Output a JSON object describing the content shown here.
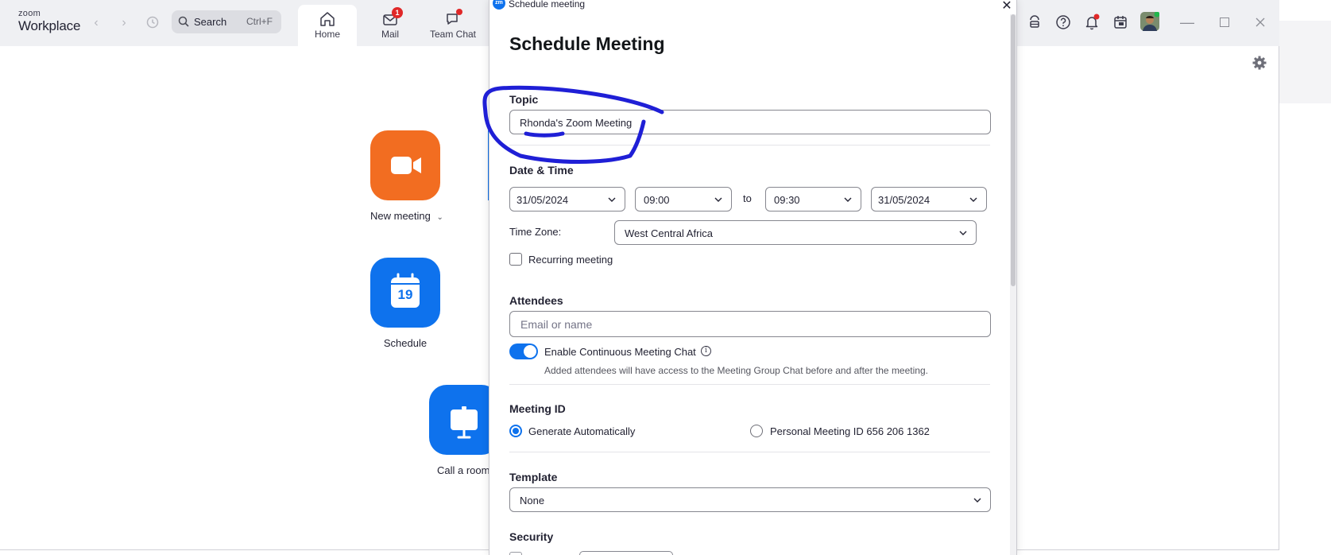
{
  "app": {
    "logo_top": "zoom",
    "logo_bottom": "Workplace",
    "search_label": "Search",
    "search_shortcut": "Ctrl+F",
    "tabs": [
      {
        "label": "Home",
        "active": true,
        "icon": "home-icon"
      },
      {
        "label": "Mail",
        "badge": "1",
        "icon": "mail-icon"
      },
      {
        "label": "Team Chat",
        "dot": true,
        "icon": "chat-icon"
      }
    ],
    "colors": {
      "accent": "#0e72ed",
      "orange": "#f26d21",
      "badge": "#e02828"
    }
  },
  "home": {
    "new_meeting_label": "New meeting",
    "schedule_label": "Schedule",
    "schedule_day": "19",
    "call_room_label": "Call a room"
  },
  "dialog": {
    "window_title": "Schedule meeting",
    "heading": "Schedule Meeting",
    "topic": {
      "label": "Topic",
      "value": "Rhonda's Zoom Meeting"
    },
    "datetime": {
      "label": "Date & Time",
      "start_date": "31/05/2024",
      "start_time": "09:00",
      "to_label": "to",
      "end_time": "09:30",
      "end_date": "31/05/2024"
    },
    "timezone": {
      "label": "Time Zone:",
      "value": "West Central Africa"
    },
    "recurring_label": "Recurring meeting",
    "attendees": {
      "label": "Attendees",
      "placeholder": "Email or name",
      "chat_toggle_label": "Enable Continuous Meeting Chat",
      "chat_help": "Added attendees will have access to the Meeting Group Chat before and after the meeting."
    },
    "meeting_id": {
      "label": "Meeting ID",
      "option_auto": "Generate Automatically",
      "option_personal": "Personal Meeting ID 656 206 1362"
    },
    "template": {
      "label": "Template",
      "value": "None"
    },
    "security": {
      "label": "Security"
    }
  }
}
